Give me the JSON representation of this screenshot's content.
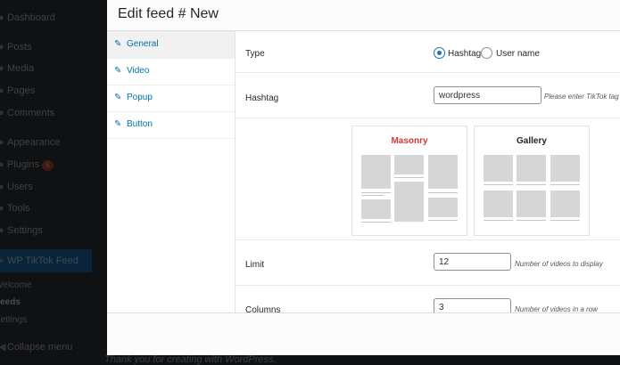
{
  "wp_menu": {
    "items": [
      {
        "label": "Dashboard"
      },
      {
        "label": "Posts"
      },
      {
        "label": "Media"
      },
      {
        "label": "Pages"
      },
      {
        "label": "Comments"
      },
      {
        "label": "Appearance"
      },
      {
        "label": "Plugins",
        "badge": "6"
      },
      {
        "label": "Users"
      },
      {
        "label": "Tools"
      },
      {
        "label": "Settings"
      },
      {
        "label": "WP TikTok Feed"
      }
    ],
    "submenu": [
      "Welcome",
      "Feeds",
      "Settings"
    ],
    "collapse_label": "Collapse menu"
  },
  "footer_text": "Thank you for creating with WordPress.",
  "modal": {
    "title": "Edit feed # New",
    "tabs": [
      {
        "label": "General",
        "icon": "wrench-icon",
        "active": true
      },
      {
        "label": "Video",
        "icon": "wrench-icon"
      },
      {
        "label": "Popup",
        "icon": "wrench-icon"
      },
      {
        "label": "Button",
        "icon": "wrench-icon"
      }
    ],
    "type": {
      "label": "Type",
      "options": [
        {
          "label": "Hashtag",
          "checked": true
        },
        {
          "label": "User name",
          "checked": false
        }
      ]
    },
    "hashtag": {
      "label": "Hashtag",
      "value": "wordpress",
      "hint": "Please enter TikTok tag"
    },
    "layouts": [
      {
        "label": "Masonry",
        "color": "#d63638",
        "selected": true
      },
      {
        "label": "Gallery",
        "color": "#1d2327",
        "selected": false
      }
    ],
    "limit": {
      "label": "Limit",
      "value": "12",
      "hint": "Number of videos to display"
    },
    "columns": {
      "label": "Columns",
      "value": "3",
      "hint": "Number of videos in a row"
    }
  }
}
